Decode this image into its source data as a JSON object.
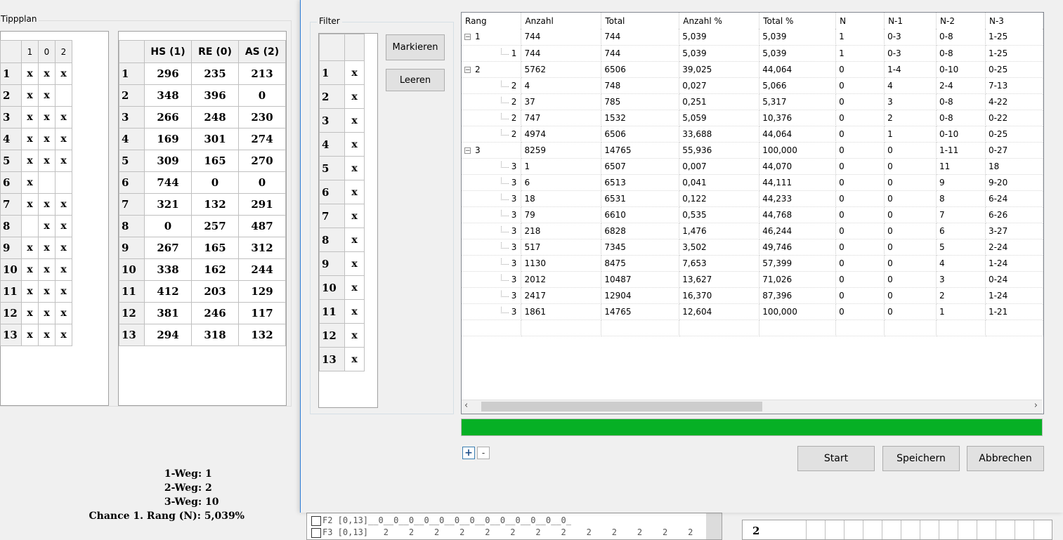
{
  "tippplan": {
    "title": "Tippplan",
    "headers": [
      "1",
      "0",
      "2"
    ],
    "rows": [
      {
        "n": "1",
        "c": [
          "x",
          "x",
          "x"
        ]
      },
      {
        "n": "2",
        "c": [
          "x",
          "x",
          ""
        ]
      },
      {
        "n": "3",
        "c": [
          "x",
          "x",
          "x"
        ]
      },
      {
        "n": "4",
        "c": [
          "x",
          "x",
          "x"
        ]
      },
      {
        "n": "5",
        "c": [
          "x",
          "x",
          "x"
        ]
      },
      {
        "n": "6",
        "c": [
          "x",
          "",
          ""
        ]
      },
      {
        "n": "7",
        "c": [
          "x",
          "x",
          "x"
        ]
      },
      {
        "n": "8",
        "c": [
          "",
          "x",
          "x"
        ]
      },
      {
        "n": "9",
        "c": [
          "x",
          "x",
          "x"
        ]
      },
      {
        "n": "10",
        "c": [
          "x",
          "x",
          "x"
        ]
      },
      {
        "n": "11",
        "c": [
          "x",
          "x",
          "x"
        ]
      },
      {
        "n": "12",
        "c": [
          "x",
          "x",
          "x"
        ]
      },
      {
        "n": "13",
        "c": [
          "x",
          "x",
          "x"
        ]
      }
    ]
  },
  "stats": {
    "headers": [
      "HS (1)",
      "RE (0)",
      "AS (2)"
    ],
    "rows": [
      {
        "n": "1",
        "c": [
          "296",
          "235",
          "213"
        ]
      },
      {
        "n": "2",
        "c": [
          "348",
          "396",
          "0"
        ]
      },
      {
        "n": "3",
        "c": [
          "266",
          "248",
          "230"
        ]
      },
      {
        "n": "4",
        "c": [
          "169",
          "301",
          "274"
        ]
      },
      {
        "n": "5",
        "c": [
          "309",
          "165",
          "270"
        ]
      },
      {
        "n": "6",
        "c": [
          "744",
          "0",
          "0"
        ]
      },
      {
        "n": "7",
        "c": [
          "321",
          "132",
          "291"
        ]
      },
      {
        "n": "8",
        "c": [
          "0",
          "257",
          "487"
        ]
      },
      {
        "n": "9",
        "c": [
          "267",
          "165",
          "312"
        ]
      },
      {
        "n": "10",
        "c": [
          "338",
          "162",
          "244"
        ]
      },
      {
        "n": "11",
        "c": [
          "412",
          "203",
          "129"
        ]
      },
      {
        "n": "12",
        "c": [
          "381",
          "246",
          "117"
        ]
      },
      {
        "n": "13",
        "c": [
          "294",
          "318",
          "132"
        ]
      }
    ]
  },
  "summary": [
    {
      "label": "1-Weg:",
      "value": "1"
    },
    {
      "label": "2-Weg:",
      "value": "2"
    },
    {
      "label": "3-Weg:",
      "value": "10"
    },
    {
      "label": "Chance 1. Rang (N):",
      "value": "5,039%"
    }
  ],
  "filter": {
    "title": "Filter",
    "rows": [
      "1",
      "2",
      "3",
      "4",
      "5",
      "6",
      "7",
      "8",
      "9",
      "10",
      "11",
      "12",
      "13"
    ],
    "mark": "x",
    "markieren": "Markieren",
    "leeren": "Leeren"
  },
  "list": {
    "columns": [
      "Rang",
      "Anzahl",
      "Total",
      "Anzahl %",
      "Total %",
      "N",
      "N-1",
      "N-2",
      "N-3"
    ],
    "rows": [
      {
        "lvl": 0,
        "expander": "−",
        "rang": "1",
        "c": [
          "744",
          "744",
          "5,039",
          "5,039",
          "1",
          "0-3",
          "0-8",
          "1-25"
        ]
      },
      {
        "lvl": 1,
        "rang": "1",
        "c": [
          "744",
          "744",
          "5,039",
          "5,039",
          "1",
          "0-3",
          "0-8",
          "1-25"
        ]
      },
      {
        "lvl": 0,
        "expander": "−",
        "rang": "2",
        "c": [
          "5762",
          "6506",
          "39,025",
          "44,064",
          "0",
          "1-4",
          "0-10",
          "0-25"
        ]
      },
      {
        "lvl": 1,
        "rang": "2",
        "c": [
          "4",
          "748",
          "0,027",
          "5,066",
          "0",
          "4",
          "2-4",
          "7-13"
        ]
      },
      {
        "lvl": 1,
        "rang": "2",
        "c": [
          "37",
          "785",
          "0,251",
          "5,317",
          "0",
          "3",
          "0-8",
          "4-22"
        ]
      },
      {
        "lvl": 1,
        "rang": "2",
        "c": [
          "747",
          "1532",
          "5,059",
          "10,376",
          "0",
          "2",
          "0-8",
          "0-22"
        ]
      },
      {
        "lvl": 1,
        "rang": "2",
        "c": [
          "4974",
          "6506",
          "33,688",
          "44,064",
          "0",
          "1",
          "0-10",
          "0-25"
        ]
      },
      {
        "lvl": 0,
        "expander": "−",
        "rang": "3",
        "c": [
          "8259",
          "14765",
          "55,936",
          "100,000",
          "0",
          "0",
          "1-11",
          "0-27"
        ]
      },
      {
        "lvl": 1,
        "rang": "3",
        "c": [
          "1",
          "6507",
          "0,007",
          "44,070",
          "0",
          "0",
          "11",
          "18"
        ]
      },
      {
        "lvl": 1,
        "rang": "3",
        "c": [
          "6",
          "6513",
          "0,041",
          "44,111",
          "0",
          "0",
          "9",
          "9-20"
        ]
      },
      {
        "lvl": 1,
        "rang": "3",
        "c": [
          "18",
          "6531",
          "0,122",
          "44,233",
          "0",
          "0",
          "8",
          "6-24"
        ]
      },
      {
        "lvl": 1,
        "rang": "3",
        "c": [
          "79",
          "6610",
          "0,535",
          "44,768",
          "0",
          "0",
          "7",
          "6-26"
        ]
      },
      {
        "lvl": 1,
        "rang": "3",
        "c": [
          "218",
          "6828",
          "1,476",
          "46,244",
          "0",
          "0",
          "6",
          "3-27"
        ]
      },
      {
        "lvl": 1,
        "rang": "3",
        "c": [
          "517",
          "7345",
          "3,502",
          "49,746",
          "0",
          "0",
          "5",
          "2-24"
        ]
      },
      {
        "lvl": 1,
        "rang": "3",
        "c": [
          "1130",
          "8475",
          "7,653",
          "57,399",
          "0",
          "0",
          "4",
          "1-24"
        ]
      },
      {
        "lvl": 1,
        "rang": "3",
        "c": [
          "2012",
          "10487",
          "13,627",
          "71,026",
          "0",
          "0",
          "3",
          "0-24"
        ]
      },
      {
        "lvl": 1,
        "rang": "3",
        "c": [
          "2417",
          "12904",
          "16,370",
          "87,396",
          "0",
          "0",
          "2",
          "1-24"
        ]
      },
      {
        "lvl": 1,
        "rang": "3",
        "c": [
          "1861",
          "14765",
          "12,604",
          "100,000",
          "0",
          "0",
          "1",
          "1-21"
        ]
      }
    ]
  },
  "progress": {
    "value": 1.0,
    "color": "#06b025"
  },
  "expand_buttons": {
    "plus": "+",
    "minus": "-"
  },
  "buttons": {
    "start": "Start",
    "speichern": "Speichern",
    "abbrechen": "Abbrechen"
  },
  "background_list": {
    "line1": "F2 [0,13]__0__0__0__0__0__0__0__0__0__0__0__0__0_",
    "line2": "F3 [0,13]   2    2    2    2    2    2    2    2    2    2    2    2    2",
    "right_value": "2"
  }
}
